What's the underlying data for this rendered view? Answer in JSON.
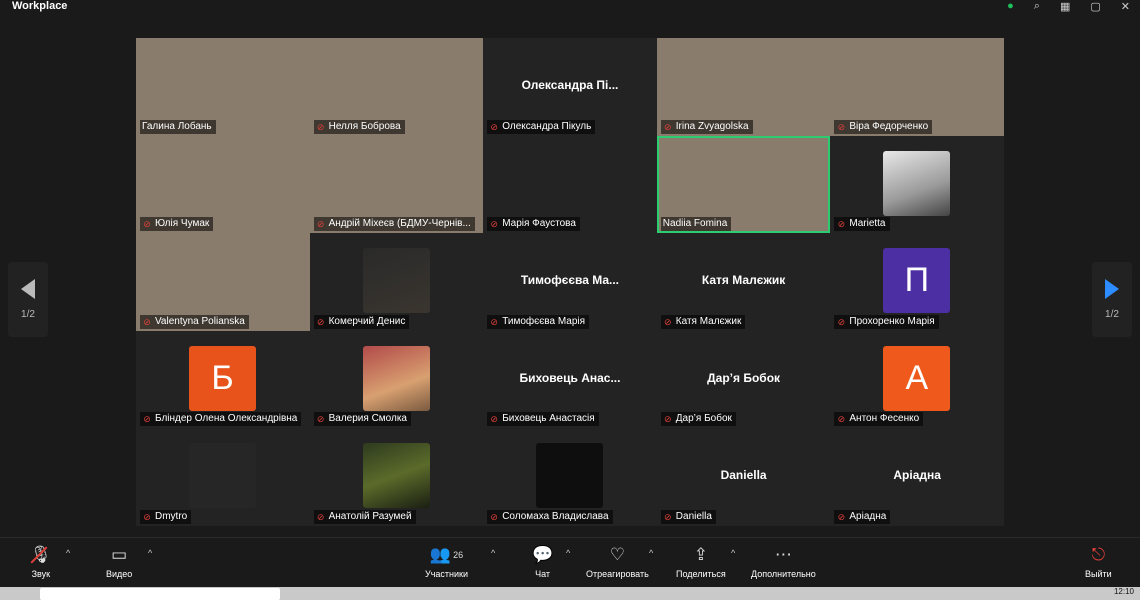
{
  "app": {
    "title": "Workplace"
  },
  "participants": [
    {
      "name": "Галина Лобань",
      "type": "video",
      "photo": "ph1"
    },
    {
      "name": "Нелля Боброва",
      "type": "video",
      "photo": "ph2",
      "muted": true
    },
    {
      "name": "Олександра Пікуль",
      "type": "name",
      "display": "Олександра  Пі...",
      "muted": true
    },
    {
      "name": "Irina Zvyagolska",
      "type": "video",
      "photo": "ph4",
      "muted": true
    },
    {
      "name": "Віра Федорченко",
      "type": "video",
      "photo": "ph5",
      "muted": true
    },
    {
      "name": "Юлія Чумак",
      "type": "video",
      "photo": "ph7",
      "muted": true
    },
    {
      "name": "Андрій Міхеєв (БДМУ-Чернів...",
      "type": "video",
      "photo": "ph6",
      "muted": true
    },
    {
      "name": "Марія Фаустова",
      "type": "blank",
      "muted": true
    },
    {
      "name": "Nadiia Fomina",
      "type": "video",
      "photo": "ph8",
      "active": true
    },
    {
      "name": "Marietta",
      "type": "photo",
      "photo": "ph-mar",
      "muted": true
    },
    {
      "name": "Valentyna Polianska",
      "type": "video",
      "photo": "ph1",
      "muted": true
    },
    {
      "name": "Комерчий Денис",
      "type": "photo",
      "photo": "ph3",
      "muted": true
    },
    {
      "name": "Тимофєєва Марія",
      "type": "name",
      "display": "Тимофєєва  Ма...",
      "muted": true
    },
    {
      "name": "Катя Малєжик",
      "type": "name",
      "display": "Катя Малєжик",
      "muted": true
    },
    {
      "name": "Прохоренко Марія",
      "type": "avatar",
      "letter": "П",
      "color": "#4b2fa3",
      "muted": true
    },
    {
      "name": "Бліндер Олена Олександрівна",
      "type": "avatar",
      "letter": "Б",
      "color": "#e8531c",
      "muted": true
    },
    {
      "name": "Валерия Смолка",
      "type": "photo",
      "photo": "ph-smolka",
      "muted": true
    },
    {
      "name": "Биховець Анастасія",
      "type": "name",
      "display": "Биховець  Анас...",
      "muted": true
    },
    {
      "name": "Дар’я Бобок",
      "type": "name",
      "display": "Дар’я Бобок",
      "muted": true
    },
    {
      "name": "Антон Фесенко",
      "type": "avatar",
      "letter": "А",
      "color": "#ef5a1c",
      "muted": true
    },
    {
      "name": "Dmytro",
      "type": "photo",
      "photo": "ph-dark",
      "muted": true
    },
    {
      "name": "Анатолій Разумей",
      "type": "photo",
      "photo": "ph-razum",
      "muted": true
    },
    {
      "name": "Соломаха Владислава",
      "type": "photo",
      "photo": "ph-sol",
      "muted": true
    },
    {
      "name": "Daniella",
      "type": "name",
      "display": "Daniella",
      "muted": true
    },
    {
      "name": "Аріадна",
      "type": "name",
      "display": "Аріадна",
      "muted": true
    }
  ],
  "pagination": {
    "prev": "1/2",
    "next": "1/2"
  },
  "toolbar": {
    "audio": "Звук",
    "video": "Видео",
    "participants": "Участники",
    "participants_count": "26",
    "chat": "Чат",
    "react": "Отреагировать",
    "share": "Поделиться",
    "more": "Дополнительно",
    "leave": "Выйти"
  },
  "taskbar": {
    "time": "12:10"
  },
  "colors": {
    "accent": "#2d8cff",
    "active_speaker": "#2ecc71",
    "muted": "#e0403a"
  }
}
